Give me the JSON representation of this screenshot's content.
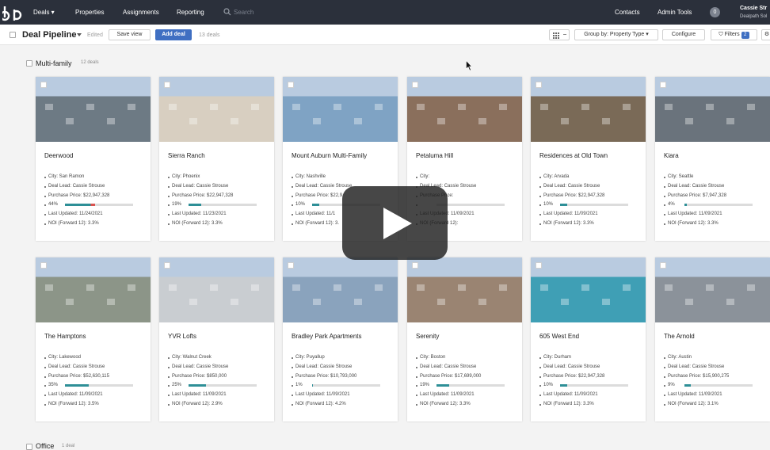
{
  "nav": {
    "items": [
      "Deals",
      "Properties",
      "Assignments",
      "Reporting"
    ],
    "search_placeholder": "Search",
    "contacts": "Contacts",
    "admin": "Admin Tools",
    "badge": "0",
    "user": "Cassie Str",
    "org": "Dealpath Sol"
  },
  "toolbar": {
    "title": "Deal Pipeline",
    "edited": "Edited",
    "save_view": "Save view",
    "add_deal": "Add deal",
    "deal_count": "13 deals",
    "group_by": "Group by: Property Type",
    "configure": "Configure",
    "filters": "Filters",
    "filters_count": "2"
  },
  "section": {
    "title": "Multi-family",
    "count": "12 deals"
  },
  "bottom_section": {
    "title": "Office",
    "count": "1 deal"
  },
  "cards": [
    {
      "title": "Deerwood",
      "lines": [
        "City: San Ramon",
        "Deal Lead: Cassie Strouse",
        "Purchase Price: $22,947,328",
        "44%",
        "Last Updated: 11/24/2021",
        "NOI (Forward 12): 3.3%"
      ],
      "progress": 0.44,
      "img": "#6d7a84"
    },
    {
      "title": "Sierra Ranch",
      "lines": [
        "City: Phoenix",
        "Deal Lead: Cassie Strouse",
        "Purchase Price: $22,947,328",
        "19%",
        "Last Updated: 11/23/2021",
        "NOI (Forward 12): 3.3%"
      ],
      "progress": 0.19,
      "img": "#d8cfc1"
    },
    {
      "title": "Mount Auburn Multi-Family",
      "lines": [
        "City: Nashville",
        "Deal Lead: Cassie Strouse",
        "Purchase Price: $22,9",
        "10%",
        "Last Updated: 11/1",
        "NOI (Forward 12): 3."
      ],
      "progress": 0.1,
      "img": "#7fa3c4"
    },
    {
      "title": "Petaluma Hill",
      "lines": [
        "City:",
        "Deal Lead: Cassie Strouse",
        "Purchase Price:",
        "",
        "Last Updated: 11/09/2021",
        "NOI (Forward 12):"
      ],
      "progress": 0.0,
      "img": "#8a6f5c"
    },
    {
      "title": "Residences at Old Town",
      "lines": [
        "City: Arvada",
        "Deal Lead: Cassie Strouse",
        "Purchase Price: $22,947,328",
        "10%",
        "Last Updated: 11/09/2021",
        "NOI (Forward 12): 3.3%"
      ],
      "progress": 0.1,
      "img": "#7a6a57"
    },
    {
      "title": "Kiara",
      "lines": [
        "City: Seattle",
        "Deal Lead: Cassie Strouse",
        "Purchase Price: $7,947,328",
        "4%",
        "Last Updated: 11/09/2021",
        "NOI (Forward 12): 3.3%"
      ],
      "progress": 0.04,
      "img": "#6a737c"
    },
    {
      "title": "The Hamptons",
      "lines": [
        "City: Lakewood",
        "Deal Lead: Cassie Strouse",
        "Purchase Price: $52,630,115",
        "35%",
        "Last Updated: 11/09/2021",
        "NOI (Forward 12): 3.5%"
      ],
      "progress": 0.35,
      "img": "#8c9588"
    },
    {
      "title": "YVR Lofts",
      "lines": [
        "City: Walnut Creek",
        "Deal Lead: Cassie Strouse",
        "Purchase Price: $850,000",
        "25%",
        "Last Updated: 11/09/2021",
        "NOI (Forward 12): 2.9%"
      ],
      "progress": 0.25,
      "img": "#c9cdd1"
    },
    {
      "title": "Bradley Park Apartments",
      "lines": [
        "City: Puyallup",
        "Deal Lead: Cassie Strouse",
        "Purchase Price: $10,793,000",
        "1%",
        "Last Updated: 11/09/2021",
        "NOI (Forward 12): 4.2%"
      ],
      "progress": 0.01,
      "img": "#8aa3bd"
    },
    {
      "title": "Serenity",
      "lines": [
        "City: Boston",
        "Deal Lead: Cassie Strouse",
        "Purchase Price: $17,699,000",
        "19%",
        "Last Updated: 11/09/2021",
        "NOI (Forward 12): 3.3%"
      ],
      "progress": 0.19,
      "img": "#9a8472"
    },
    {
      "title": "605 West End",
      "lines": [
        "City: Durham",
        "Deal Lead: Cassie Strouse",
        "Purchase Price: $22,947,328",
        "10%",
        "Last Updated: 11/09/2021",
        "NOI (Forward 12): 3.3%"
      ],
      "progress": 0.1,
      "img": "#3f9fb5"
    },
    {
      "title": "The Arnold",
      "lines": [
        "City: Austin",
        "Deal Lead: Cassie Strouse",
        "Purchase Price: $15,900,275",
        "9%",
        "Last Updated: 11/09/2021",
        "NOI (Forward 12): 3.1%"
      ],
      "progress": 0.09,
      "img": "#8b929a"
    }
  ],
  "colors": {
    "nav": "#2b303b",
    "accent": "#3f6fc2",
    "progress": "#2e8f97"
  },
  "icons": [
    "dp-logo-icon",
    "search-icon",
    "chevron-down-icon",
    "grid-view-icon",
    "filter-icon",
    "play-icon",
    "cursor-icon"
  ]
}
